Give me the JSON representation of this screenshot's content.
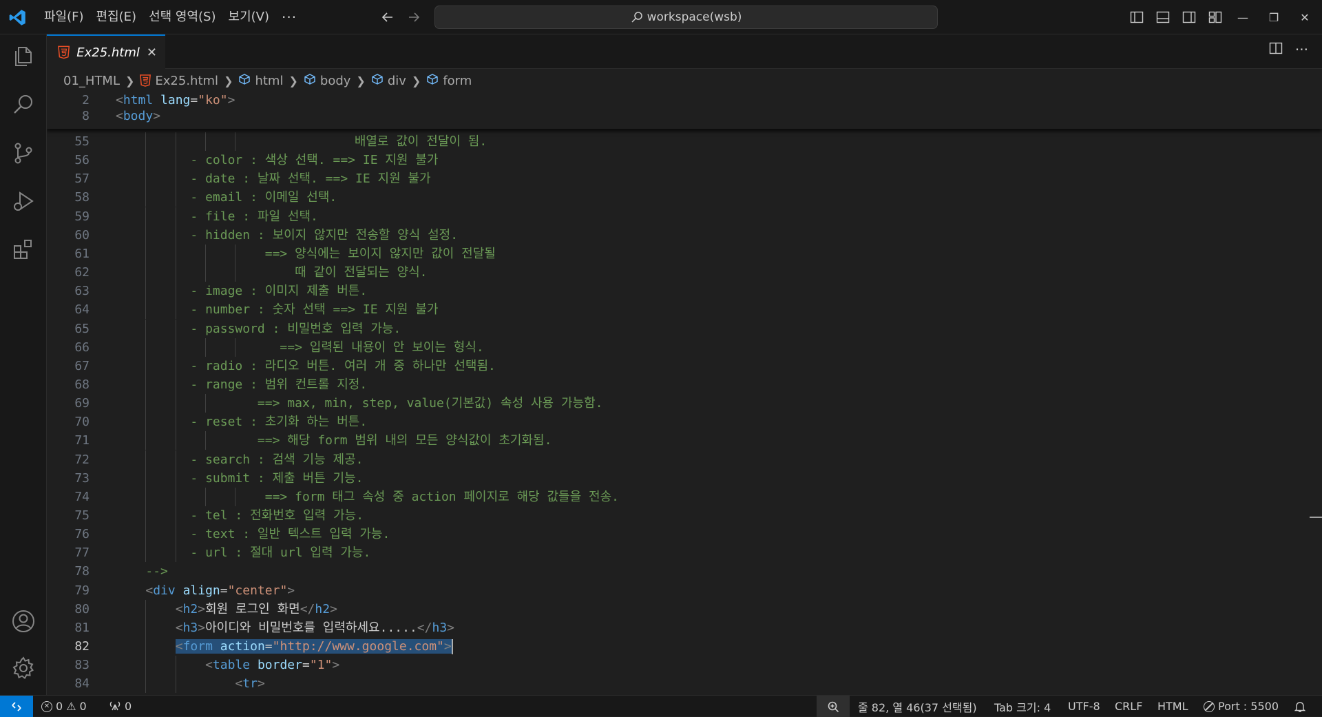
{
  "titlebar": {
    "menu": [
      "파일(F)",
      "편집(E)",
      "선택 영역(S)",
      "보기(V)"
    ],
    "more": "···",
    "search": "workspace(wsb)",
    "window_controls": {
      "minimize": "—",
      "restore": "❐",
      "close": "✕"
    }
  },
  "activity": [
    "files-icon",
    "search-icon",
    "source-control-icon",
    "run-debug-icon",
    "extensions-icon",
    "account-icon",
    "settings-gear-icon"
  ],
  "tab": {
    "label": "Ex25.html",
    "close": "✕"
  },
  "breadcrumb": {
    "folder": "01_HTML",
    "file": "Ex25.html",
    "items": [
      "html",
      "body",
      "div",
      "form"
    ]
  },
  "sticky": {
    "lines": [
      {
        "num": "2",
        "code": [
          [
            "c-punct",
            "<"
          ],
          [
            "c-tag",
            "html"
          ],
          [
            "c-text",
            " "
          ],
          [
            "c-attr",
            "lang"
          ],
          [
            "c-text",
            "="
          ],
          [
            "c-val",
            "\"ko\""
          ],
          [
            "c-punct",
            ">"
          ]
        ]
      },
      {
        "num": "8",
        "code": [
          [
            "c-punct",
            "<"
          ],
          [
            "c-tag",
            "body"
          ],
          [
            "c-punct",
            ">"
          ]
        ]
      }
    ]
  },
  "code": {
    "lines": [
      {
        "num": "55",
        "indent": 14,
        "guides": [
          2,
          3,
          4,
          5
        ],
        "code": [
          [
            "c-comment",
            "                  배열로 값이 전달이 됨."
          ]
        ]
      },
      {
        "num": "56",
        "indent": 10,
        "guides": [
          2,
          3
        ],
        "code": [
          [
            "c-comment",
            "- color : 색상 선택. ==> IE 지원 불가"
          ]
        ]
      },
      {
        "num": "57",
        "indent": 10,
        "guides": [
          2,
          3
        ],
        "code": [
          [
            "c-comment",
            "- date : 날짜 선택. ==> IE 지원 불가"
          ]
        ]
      },
      {
        "num": "58",
        "indent": 10,
        "guides": [
          2,
          3
        ],
        "code": [
          [
            "c-comment",
            "- email : 이메일 선택."
          ]
        ]
      },
      {
        "num": "59",
        "indent": 10,
        "guides": [
          2,
          3
        ],
        "code": [
          [
            "c-comment",
            "- file : 파일 선택."
          ]
        ]
      },
      {
        "num": "60",
        "indent": 10,
        "guides": [
          2,
          3
        ],
        "code": [
          [
            "c-comment",
            "- hidden : 보이지 않지만 전송할 양식 설정."
          ]
        ]
      },
      {
        "num": "61",
        "indent": 10,
        "guides": [
          2,
          3,
          4,
          5
        ],
        "code": [
          [
            "c-comment",
            "          ==> 양식에는 보이지 않지만 값이 전달될"
          ]
        ]
      },
      {
        "num": "62",
        "indent": 10,
        "guides": [
          2,
          3,
          4,
          5
        ],
        "code": [
          [
            "c-comment",
            "              때 같이 전달되는 양식."
          ]
        ]
      },
      {
        "num": "63",
        "indent": 10,
        "guides": [
          2,
          3
        ],
        "code": [
          [
            "c-comment",
            "- image : 이미지 제출 버튼."
          ]
        ]
      },
      {
        "num": "64",
        "indent": 10,
        "guides": [
          2,
          3
        ],
        "code": [
          [
            "c-comment",
            "- number : 숫자 선택 ==> IE 지원 불가"
          ]
        ]
      },
      {
        "num": "65",
        "indent": 10,
        "guides": [
          2,
          3
        ],
        "code": [
          [
            "c-comment",
            "- password : 비밀번호 입력 가능."
          ]
        ]
      },
      {
        "num": "66",
        "indent": 10,
        "guides": [
          2,
          3,
          4,
          5
        ],
        "code": [
          [
            "c-comment",
            "            ==> 입력된 내용이 안 보이는 형식."
          ]
        ]
      },
      {
        "num": "67",
        "indent": 10,
        "guides": [
          2,
          3
        ],
        "code": [
          [
            "c-comment",
            "- radio : 라디오 버튼. 여러 개 중 하나만 선택됨."
          ]
        ]
      },
      {
        "num": "68",
        "indent": 10,
        "guides": [
          2,
          3
        ],
        "code": [
          [
            "c-comment",
            "- range : 범위 컨트롤 지정."
          ]
        ]
      },
      {
        "num": "69",
        "indent": 10,
        "guides": [
          2,
          3,
          4
        ],
        "code": [
          [
            "c-comment",
            "         ==> max, min, step, value(기본값) 속성 사용 가능함."
          ]
        ]
      },
      {
        "num": "70",
        "indent": 10,
        "guides": [
          2,
          3
        ],
        "code": [
          [
            "c-comment",
            "- reset : 초기화 하는 버튼."
          ]
        ]
      },
      {
        "num": "71",
        "indent": 10,
        "guides": [
          2,
          3,
          4
        ],
        "code": [
          [
            "c-comment",
            "         ==> 해당 form 범위 내의 모든 양식값이 초기화됨."
          ]
        ]
      },
      {
        "num": "72",
        "indent": 10,
        "guides": [
          2,
          3
        ],
        "code": [
          [
            "c-comment",
            "- search : 검색 기능 제공."
          ]
        ]
      },
      {
        "num": "73",
        "indent": 10,
        "guides": [
          2,
          3
        ],
        "code": [
          [
            "c-comment",
            "- submit : 제출 버튼 기능."
          ]
        ]
      },
      {
        "num": "74",
        "indent": 10,
        "guides": [
          2,
          3,
          4,
          5
        ],
        "code": [
          [
            "c-comment",
            "          ==> form 태그 속성 중 action 페이지로 해당 값들을 전송."
          ]
        ]
      },
      {
        "num": "75",
        "indent": 10,
        "guides": [
          2,
          3
        ],
        "code": [
          [
            "c-comment",
            "- tel : 전화번호 입력 가능."
          ]
        ]
      },
      {
        "num": "76",
        "indent": 10,
        "guides": [
          2,
          3
        ],
        "code": [
          [
            "c-comment",
            "- text : 일반 텍스트 입력 가능."
          ]
        ]
      },
      {
        "num": "77",
        "indent": 10,
        "guides": [
          2,
          3
        ],
        "code": [
          [
            "c-comment",
            "- url : 절대 url 입력 가능."
          ]
        ]
      },
      {
        "num": "78",
        "indent": 4,
        "guides": [],
        "code": [
          [
            "c-comment",
            "-->"
          ]
        ]
      },
      {
        "num": "79",
        "indent": 4,
        "guides": [],
        "code": [
          [
            "c-punct",
            "<"
          ],
          [
            "c-tag",
            "div"
          ],
          [
            "c-text",
            " "
          ],
          [
            "c-attr",
            "align"
          ],
          [
            "c-text",
            "="
          ],
          [
            "c-val",
            "\"center\""
          ],
          [
            "c-punct",
            ">"
          ]
        ]
      },
      {
        "num": "80",
        "indent": 8,
        "guides": [
          2
        ],
        "code": [
          [
            "c-punct",
            "<"
          ],
          [
            "c-tag",
            "h2"
          ],
          [
            "c-punct",
            ">"
          ],
          [
            "c-text",
            "회원 로그인 화면"
          ],
          [
            "c-punct",
            "</"
          ],
          [
            "c-tag",
            "h2"
          ],
          [
            "c-punct",
            ">"
          ]
        ]
      },
      {
        "num": "81",
        "indent": 8,
        "guides": [
          2
        ],
        "code": [
          [
            "c-punct",
            "<"
          ],
          [
            "c-tag",
            "h3"
          ],
          [
            "c-punct",
            ">"
          ],
          [
            "c-text",
            "아이디와 비밀번호를 입력하세요....."
          ],
          [
            "c-punct",
            "</"
          ],
          [
            "c-tag",
            "h3"
          ],
          [
            "c-punct",
            ">"
          ]
        ]
      },
      {
        "num": "82",
        "indent": 8,
        "guides": [
          2
        ],
        "current": true,
        "code": [
          [
            "c-punct sel",
            "<"
          ],
          [
            "c-tag sel",
            "form"
          ],
          [
            "c-text sel",
            " "
          ],
          [
            "c-attr sel",
            "action"
          ],
          [
            "c-text sel",
            "="
          ],
          [
            "c-val sel",
            "\"http://www.google.com\""
          ],
          [
            "c-punct sel",
            ">"
          ]
        ]
      },
      {
        "num": "83",
        "indent": 12,
        "guides": [
          2,
          3
        ],
        "code": [
          [
            "c-punct",
            "<"
          ],
          [
            "c-tag",
            "table"
          ],
          [
            "c-text",
            " "
          ],
          [
            "c-attr",
            "border"
          ],
          [
            "c-text",
            "="
          ],
          [
            "c-val",
            "\"1\""
          ],
          [
            "c-punct",
            ">"
          ]
        ]
      },
      {
        "num": "84",
        "indent": 16,
        "guides": [
          2,
          3
        ],
        "code": [
          [
            "c-punct",
            "<"
          ],
          [
            "c-tag",
            "tr"
          ],
          [
            "c-punct",
            ">"
          ]
        ]
      }
    ]
  },
  "statusbar": {
    "errors": "0",
    "warnings": "0",
    "ports": "0",
    "position": "줄 82, 열 46(37 선택됨)",
    "tab_size": "Tab 크기: 4",
    "encoding": "UTF-8",
    "eol": "CRLF",
    "language": "HTML",
    "port": "Port : 5500"
  }
}
